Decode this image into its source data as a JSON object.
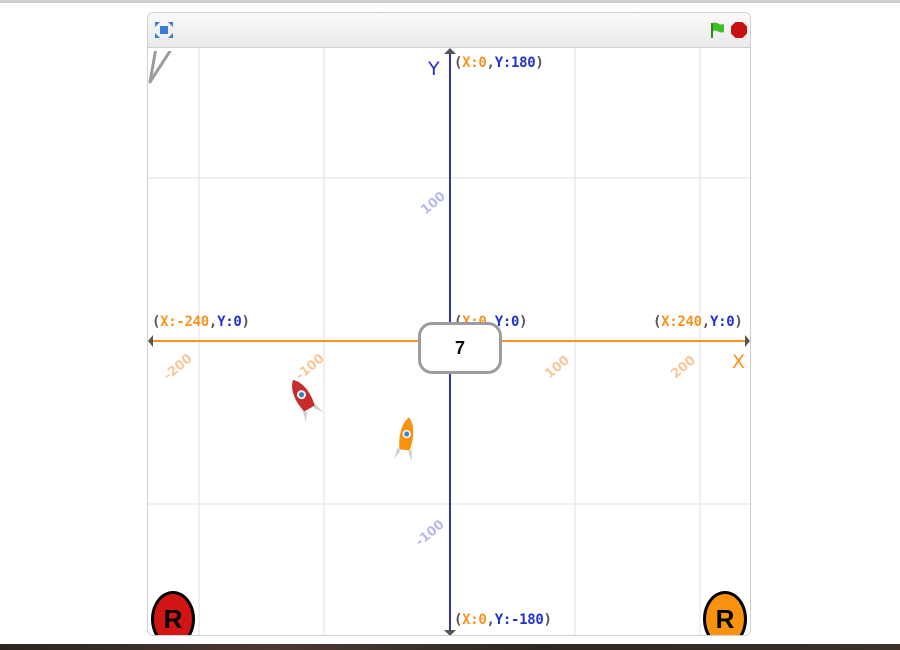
{
  "toolbar": {
    "icons": [
      "fullscreen-icon",
      "green-flag-icon",
      "stop-icon"
    ],
    "flag_color": "#3fbf26",
    "stop_color": "#c81010"
  },
  "stage": {
    "axis_labels": {
      "x": "X",
      "y": "Y"
    },
    "x_axis_color": "#f7931e",
    "y_axis_color": "#3333aa",
    "coordinates": {
      "top": {
        "x_label": "X:",
        "x_value": "0",
        "y_label": "Y:",
        "y_value": "180"
      },
      "bottom": {
        "x_label": "X:",
        "x_value": "0",
        "y_label": "Y:",
        "y_value": "-180"
      },
      "left": {
        "x_label": "X:",
        "x_value": "-240",
        "y_label": "Y:",
        "y_value": "0"
      },
      "right": {
        "x_label": "X:",
        "x_value": "240",
        "y_label": "Y:",
        "y_value": "0"
      },
      "center": {
        "x_label": "X:",
        "x_value": "0",
        "y_label": "Y:",
        "y_value": "0"
      }
    },
    "x_ticks": [
      "-200",
      "-100",
      "100",
      "200"
    ],
    "y_ticks": [
      "100",
      "-100"
    ],
    "speech_bubble": "7",
    "sprites": [
      "red-rocket-sprite",
      "orange-rocket-sprite"
    ],
    "buttons": {
      "left": {
        "label": "R",
        "color": "#d11414"
      },
      "right": {
        "label": "R",
        "color": "#f7930f"
      }
    }
  }
}
